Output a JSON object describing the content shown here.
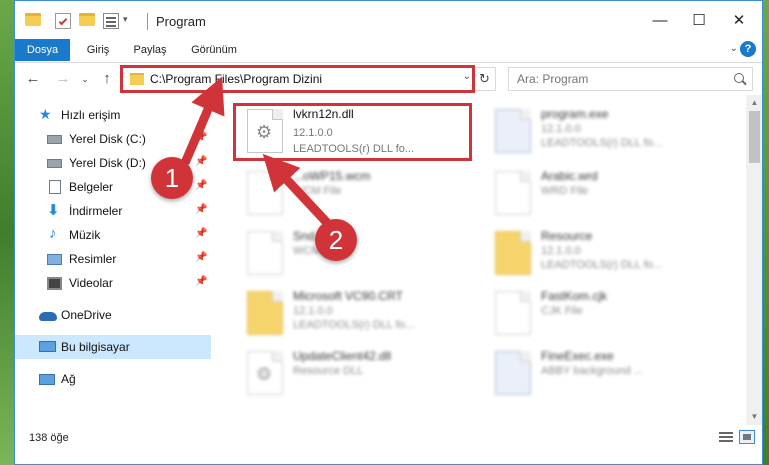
{
  "window": {
    "title": "Program",
    "controls": {
      "minimize": "—",
      "maximize": "☐",
      "close": "✕"
    }
  },
  "ribbon": {
    "tabs": [
      {
        "label": "Dosya",
        "active": true
      },
      {
        "label": "Giriş"
      },
      {
        "label": "Paylaş"
      },
      {
        "label": "Görünüm"
      }
    ]
  },
  "nav": {
    "address": "C:\\Program Files\\Program Dizini",
    "search_placeholder": "Ara: Program"
  },
  "sidebar": {
    "items": [
      {
        "label": "Hızlı erişim",
        "icon": "star-icon"
      },
      {
        "label": "Yerel Disk (C:)",
        "icon": "drive-icon",
        "pinned": true
      },
      {
        "label": "Yerel Disk (D:)",
        "icon": "drive-icon",
        "pinned": true
      },
      {
        "label": "Belgeler",
        "icon": "documents-icon",
        "pinned": true
      },
      {
        "label": "İndirmeler",
        "icon": "download-icon",
        "pinned": true
      },
      {
        "label": "Müzik",
        "icon": "music-icon",
        "pinned": true
      },
      {
        "label": "Resimler",
        "icon": "pictures-icon",
        "pinned": true
      },
      {
        "label": "Videolar",
        "icon": "videos-icon",
        "pinned": true
      },
      {
        "label": "OneDrive",
        "icon": "cloud-icon"
      },
      {
        "label": "Bu bilgisayar",
        "icon": "computer-icon",
        "selected": true
      },
      {
        "label": "Ağ",
        "icon": "network-icon"
      }
    ]
  },
  "files": {
    "highlighted": {
      "name": "lvkrn12n.dll",
      "version": "12.1.0.0",
      "description": "LEADTOOLS(r) DLL fo..."
    },
    "left": [
      {
        "name": "...oWP15.wcm",
        "sub": "WCM File"
      },
      {
        "name": "Snd... .wcm",
        "sub": "WCM File"
      },
      {
        "name": "Microsoft VC90.CRT",
        "sub": "12.1.0.0",
        "sub2": "LEADTOOLS(r) DLL fo..."
      },
      {
        "name": "UpdateClient42.dll",
        "sub": "Resource DLL"
      }
    ],
    "right": [
      {
        "name": "program.exe",
        "sub": "12.1.0.0",
        "sub2": "LEADTOOLS(r) DLL fo..."
      },
      {
        "name": "Arabic.wrd",
        "sub": "WRD File"
      },
      {
        "name": "Resource",
        "sub": "12.1.0.0",
        "sub2": "LEADTOOLS(r) DLL fo..."
      },
      {
        "name": "FastKom.cjk",
        "sub": "CJK File"
      },
      {
        "name": "FineExec.exe",
        "sub": "ABBY background ..."
      }
    ]
  },
  "status": {
    "count": "138 öğe"
  },
  "annotations": {
    "badge1": "1",
    "badge2": "2"
  },
  "colors": {
    "accent": "#1979ca",
    "highlight": "#d13438",
    "selection": "#cce8ff"
  }
}
